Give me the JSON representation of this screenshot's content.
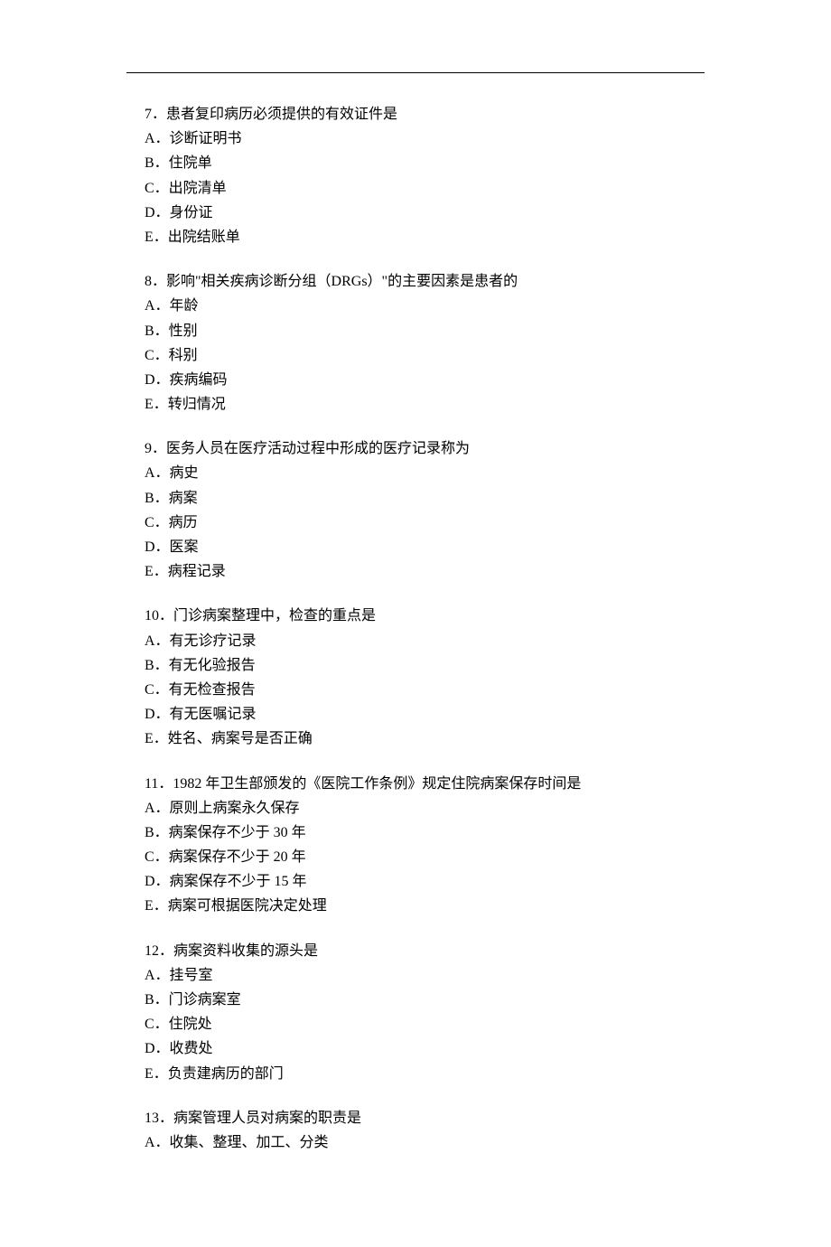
{
  "questions": [
    {
      "number": "7",
      "stem": "患者复印病历必须提供的有效证件是",
      "options": [
        {
          "label": "A",
          "text": "诊断证明书"
        },
        {
          "label": "B",
          "text": "住院单"
        },
        {
          "label": "C",
          "text": "出院清单"
        },
        {
          "label": "D",
          "text": "身份证"
        },
        {
          "label": "E",
          "text": "出院结账单"
        }
      ]
    },
    {
      "number": "8",
      "stem": "影响\"相关疾病诊断分组（DRGs）\"的主要因素是患者的",
      "options": [
        {
          "label": "A",
          "text": "年龄"
        },
        {
          "label": "B",
          "text": "性别"
        },
        {
          "label": "C",
          "text": "科别"
        },
        {
          "label": "D",
          "text": "疾病编码"
        },
        {
          "label": "E",
          "text": "转归情况"
        }
      ]
    },
    {
      "number": "9",
      "stem": "医务人员在医疗活动过程中形成的医疗记录称为",
      "options": [
        {
          "label": "A",
          "text": "病史"
        },
        {
          "label": "B",
          "text": "病案"
        },
        {
          "label": "C",
          "text": "病历"
        },
        {
          "label": "D",
          "text": "医案"
        },
        {
          "label": "E",
          "text": "病程记录"
        }
      ]
    },
    {
      "number": "10",
      "stem": "门诊病案整理中，检查的重点是",
      "options": [
        {
          "label": "A",
          "text": "有无诊疗记录"
        },
        {
          "label": "B",
          "text": "有无化验报告"
        },
        {
          "label": "C",
          "text": "有无检查报告"
        },
        {
          "label": "D",
          "text": "有无医嘱记录"
        },
        {
          "label": "E",
          "text": "姓名、病案号是否正确"
        }
      ]
    },
    {
      "number": "11",
      "stem": "1982 年卫生部颁发的《医院工作条例》规定住院病案保存时间是",
      "options": [
        {
          "label": "A",
          "text": "原则上病案永久保存"
        },
        {
          "label": "B",
          "text": "病案保存不少于 30 年"
        },
        {
          "label": "C",
          "text": "病案保存不少于 20 年"
        },
        {
          "label": "D",
          "text": "病案保存不少于 15 年"
        },
        {
          "label": "E",
          "text": "病案可根据医院决定处理"
        }
      ]
    },
    {
      "number": "12",
      "stem": "病案资料收集的源头是",
      "options": [
        {
          "label": "A",
          "text": "挂号室"
        },
        {
          "label": "B",
          "text": "门诊病案室"
        },
        {
          "label": "C",
          "text": "住院处"
        },
        {
          "label": "D",
          "text": "收费处"
        },
        {
          "label": "E",
          "text": "负责建病历的部门"
        }
      ]
    },
    {
      "number": "13",
      "stem": "病案管理人员对病案的职责是",
      "options": [
        {
          "label": "A",
          "text": "收集、整理、加工、分类"
        }
      ]
    }
  ]
}
